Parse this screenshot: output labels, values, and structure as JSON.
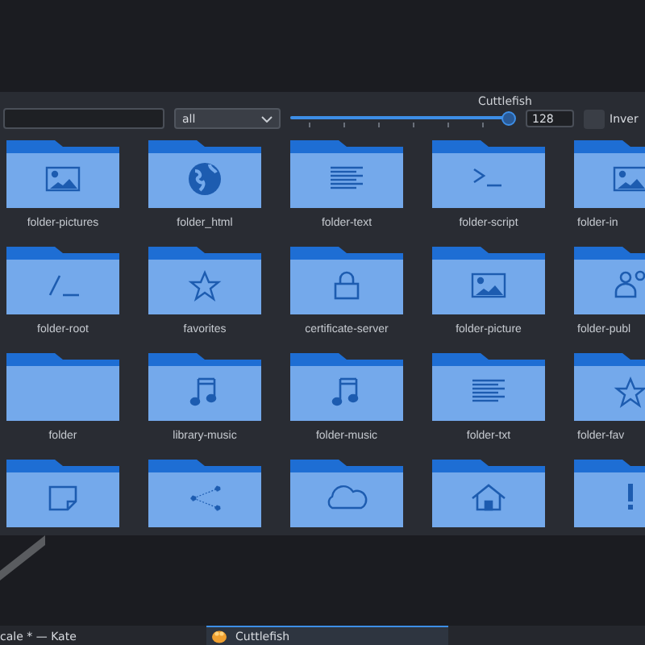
{
  "window": {
    "title": "Cuttlefish"
  },
  "toolbar": {
    "filter": {
      "value": "all"
    },
    "size_slider": {
      "level": 1.0
    },
    "size": "128",
    "invert": {
      "label": "Inver",
      "checked": false
    }
  },
  "rows": [
    [
      {
        "name": "folder-pictures",
        "kind": "picture"
      },
      {
        "name": "folder_html",
        "kind": "globe"
      },
      {
        "name": "folder-text",
        "kind": "text"
      },
      {
        "name": "folder-script",
        "kind": "terminal"
      },
      {
        "name": "folder-in",
        "kind": "picture"
      }
    ],
    [
      {
        "name": "folder-root",
        "kind": "root"
      },
      {
        "name": "favorites",
        "kind": "star"
      },
      {
        "name": "certificate-server",
        "kind": "lock"
      },
      {
        "name": "folder-picture",
        "kind": "picture"
      },
      {
        "name": "folder-publ",
        "kind": "people"
      }
    ],
    [
      {
        "name": "folder",
        "kind": "plain"
      },
      {
        "name": "library-music",
        "kind": "music"
      },
      {
        "name": "folder-music",
        "kind": "music"
      },
      {
        "name": "folder-txt",
        "kind": "text"
      },
      {
        "name": "folder-fav",
        "kind": "star"
      }
    ],
    [
      {
        "kind": "note"
      },
      {
        "kind": "share"
      },
      {
        "kind": "cloud"
      },
      {
        "kind": "home"
      },
      {
        "kind": "warning"
      }
    ]
  ],
  "taskbar": {
    "tasks": [
      {
        "label": "cale * — Kate",
        "selected": false
      },
      {
        "label": "Cuttlefish",
        "selected": true
      }
    ]
  }
}
